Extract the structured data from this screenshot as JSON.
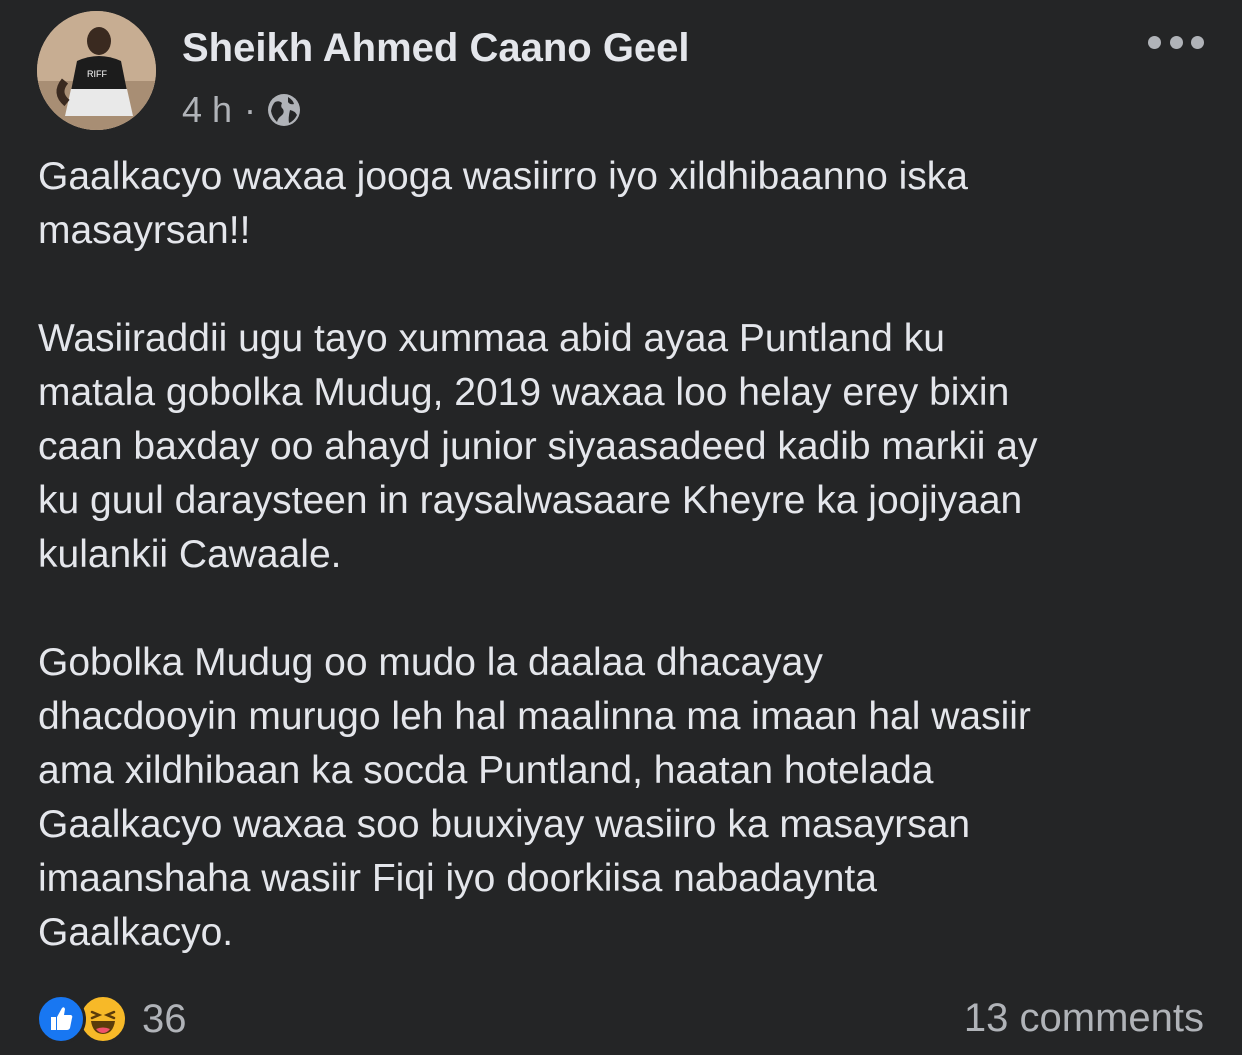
{
  "post": {
    "author": "Sheikh Ahmed Caano Geel",
    "time": "4 h",
    "separator": "·",
    "audience_icon": "globe-icon",
    "body": "Gaalkacyo waxaa jooga wasiirro iyo xildhibaanno iska\nmasayrsan!!\n\nWasiiraddii ugu tayo xummaa abid ayaa Puntland ku\nmatala gobolka Mudug, 2019 waxaa loo helay erey bixin\ncaan baxday oo ahayd junior siyaasadeed kadib markii ay\nku guul daraysteen in raysalwasaare Kheyre  ka joojiyaan\nkulankii Cawaale.\n\nGobolka Mudug oo mudo la daalaa dhacayay\ndhacdooyin murugo leh hal maalinna ma imaan hal wasiir\nama xildhibaan ka socda Puntland, haatan hotelada\nGaalkacyo waxaa soo buuxiyay wasiiro ka masayrsan\nimaanshaha wasiir Fiqi iyo doorkiisa nabadaynta\nGaalkacyo.",
    "reactions": {
      "icons": [
        "like-icon",
        "haha-icon"
      ],
      "count": "36"
    },
    "comments_label": "13 comments"
  },
  "colors": {
    "background": "#242526",
    "primary_text": "#e4e6eb",
    "secondary_text": "#b0b3b8",
    "like_blue": "#1877f2",
    "haha_yellow": "#f7b928"
  }
}
